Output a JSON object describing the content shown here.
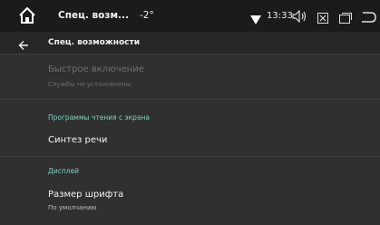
{
  "status_bar": {
    "app_title": "Спец. возм...",
    "temperature": "-2°",
    "time": "13:33",
    "icons": [
      "home-icon",
      "wifi-icon",
      "volume-icon",
      "close-box-icon",
      "window-icon",
      "back-icon"
    ]
  },
  "action_bar": {
    "title": "Спец. возможности"
  },
  "items": [
    {
      "title": "Быстрое включение",
      "subtitle": "Службы не установлены",
      "disabled": true
    },
    {
      "category": "Программы чтения с экрана"
    },
    {
      "title": "Синтез речи"
    },
    {
      "category": "Дисплей"
    },
    {
      "title": "Размер шрифта",
      "subtitle": "По умолчанию"
    }
  ],
  "colors": {
    "accent": "#7fd0c4",
    "status_bar_bg": "#1b1b1b",
    "action_bar_bg": "#262626",
    "content_bg": "#303030"
  }
}
